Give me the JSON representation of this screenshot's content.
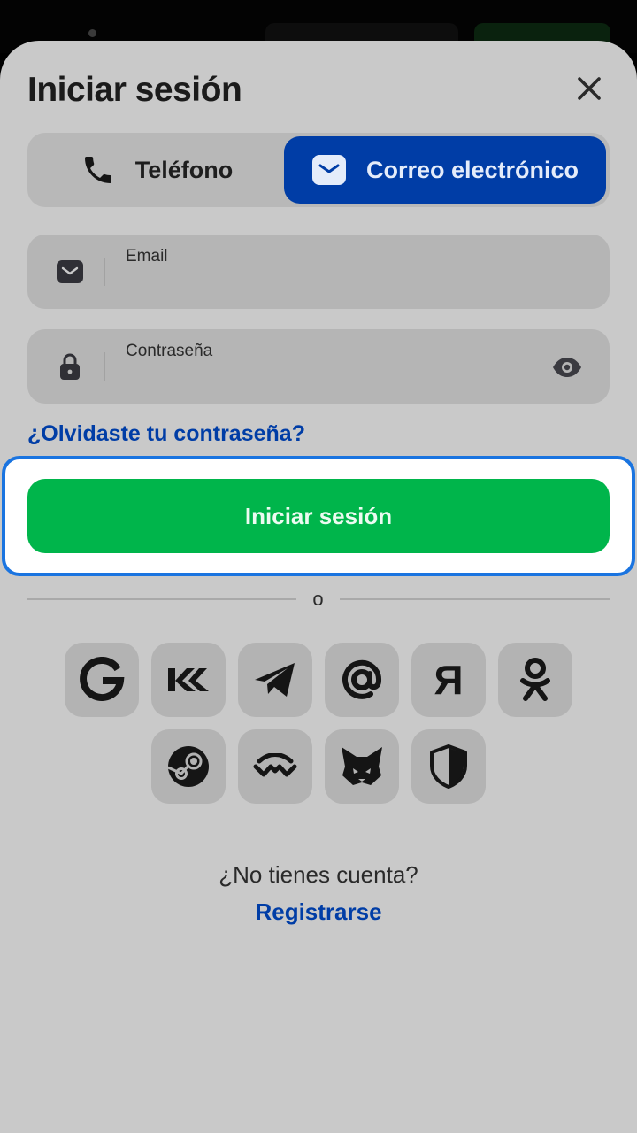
{
  "title": "Iniciar sesión",
  "tabs": {
    "phone": "Teléfono",
    "email": "Correo electrónico"
  },
  "fields": {
    "email_label": "Email",
    "email_value": "",
    "password_label": "Contraseña",
    "password_value": ""
  },
  "forgot_password": "¿Olvidaste tu contraseña?",
  "login_button": "Iniciar sesión",
  "separator": "o",
  "social": {
    "yandex_glyph": "Я"
  },
  "footer": {
    "question": "¿No tienes cuenta?",
    "register": "Registrarse"
  },
  "icons": [
    "close-icon",
    "phone-icon",
    "mail-icon",
    "lock-icon",
    "eye-icon",
    "google-icon",
    "vk-icon",
    "telegram-icon",
    "at-icon",
    "yandex-icon",
    "odnoklassniki-icon",
    "steam-icon",
    "walletconnect-icon",
    "metamask-fox-icon",
    "shield-icon"
  ],
  "colors": {
    "sheet": "#c9c9c9",
    "accent_blue": "#003da6",
    "login_green": "#00b54b",
    "highlight": "#1a74e0"
  }
}
